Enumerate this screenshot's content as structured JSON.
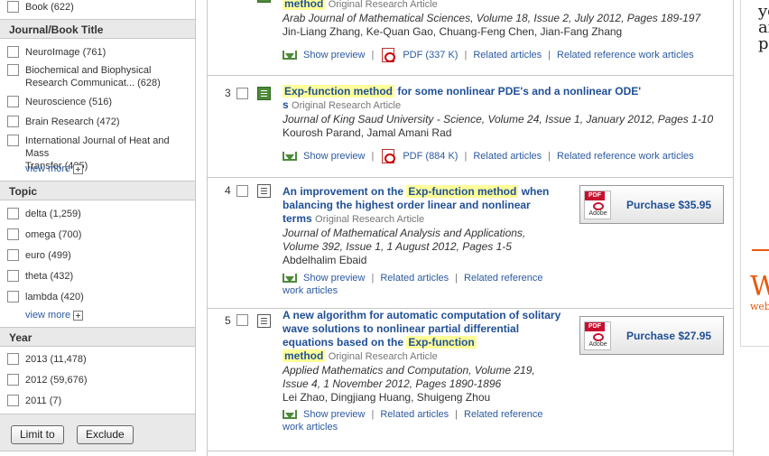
{
  "sidebar": {
    "book_item": {
      "label": "Book (622)"
    },
    "journal_section": {
      "heading": "Journal/Book Title",
      "items": [
        {
          "line1": "NeuroImage (761)",
          "line2": ""
        },
        {
          "line1": "Biochemical and Biophysical",
          "line2": "Research Communicat... (628)"
        },
        {
          "line1": "Neuroscience (516)",
          "line2": ""
        },
        {
          "line1": "Brain Research (472)",
          "line2": ""
        },
        {
          "line1": "International Journal of Heat and Mass",
          "line2": "Transfer (425)"
        }
      ],
      "view_more": "view more"
    },
    "topic_section": {
      "heading": "Topic",
      "items": [
        "delta (1,259)",
        "omega (700)",
        "euro (499)",
        "theta (432)",
        "lambda (420)"
      ],
      "view_more": "view more"
    },
    "year_section": {
      "heading": "Year",
      "items": [
        "2013 (11,478)",
        "2012 (59,676)",
        "2011 (7)"
      ]
    },
    "buttons": {
      "limit": "Limit to",
      "exclude": "Exclude"
    }
  },
  "results": [
    {
      "number": "",
      "title_highlight": "method",
      "type": "Original Research Article",
      "source": "Arab Journal of Mathematical Sciences, Volume 18, Issue 2, July 2012, Pages 189-197",
      "authors": "Jin-Liang Zhang, Ke-Quan Gao, Chuang-Feng Chen, Jian-Fang Zhang",
      "links": {
        "show_preview": "Show preview",
        "pdf": "PDF (337 K)",
        "related": "Related articles",
        "related_ref": "Related reference work articles"
      }
    },
    {
      "number": "3",
      "title_highlight": "Exp-function method",
      "title_rest": " for some nonlinear PDE's and a nonlinear ODE'",
      "title_line2": "s",
      "type": "Original Research Article",
      "source": "Journal of King Saud University - Science, Volume 24, Issue 1, January 2012, Pages 1-10",
      "authors": "Kourosh Parand, Jamal Amani Rad",
      "links": {
        "show_preview": "Show preview",
        "pdf": "PDF (884 K)",
        "related": "Related articles",
        "related_ref": "Related reference work articles"
      }
    },
    {
      "number": "4",
      "title_pre": "An improvement on the ",
      "title_highlight": "Exp-function method",
      "title_post": " when",
      "title_line2": "balancing the highest order linear and nonlinear",
      "title_line3": "terms",
      "type": "Original Research Article",
      "source_line1": "Journal of Mathematical Analysis and Applications,",
      "source_line2": "Volume 392, Issue 1, 1 August 2012, Pages 1-5",
      "authors": "Abdelhalim Ebaid",
      "links": {
        "show_preview": "Show preview",
        "related": "Related articles",
        "related_ref_line1": "Related reference",
        "related_ref_line2": "work articles"
      },
      "purchase": "Purchase $35.95"
    },
    {
      "number": "5",
      "title_line1": "A new algorithm for automatic computation of solitary",
      "title_line2": "wave solutions to nonlinear partial differential",
      "title_line3_pre": "equations based on the ",
      "title_highlight": "Exp-function",
      "title_line4": "method",
      "type": "Original Research Article",
      "source_line1": "Applied Mathematics and Computation, Volume 219,",
      "source_line2": "Issue 4, 1 November 2012, Pages 1890-1896",
      "authors": "Lei Zhao, Dingjiang Huang, Shuigeng Zhou",
      "links": {
        "show_preview": "Show preview",
        "related": "Related articles",
        "related_ref_line1": "Related reference",
        "related_ref_line2": "work articles"
      },
      "purchase": "Purchase $27.95"
    }
  ],
  "pdf_badge": {
    "top": "PDF",
    "bottom": "Adobe"
  },
  "right_panel": {
    "line1": "yc",
    "line2": "af",
    "line3": "pu",
    "big": "W",
    "small": "web"
  }
}
